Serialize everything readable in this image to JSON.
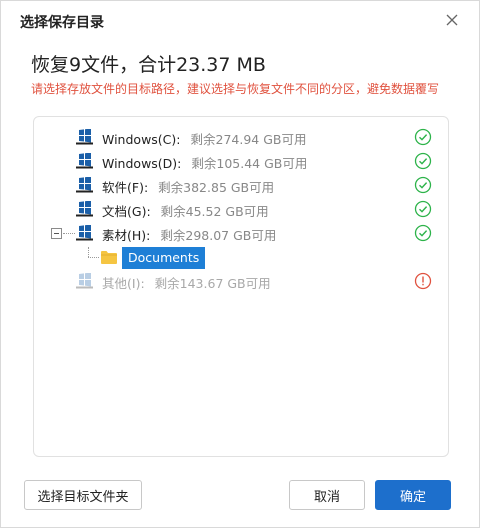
{
  "dialog": {
    "title": "选择保存目录",
    "heading": "恢复9文件，合计23.37 MB",
    "warning": "请选择存放文件的目标路径，建议选择与恢复文件不同的分区，避免数据覆写"
  },
  "drives": [
    {
      "label": "Windows(C):",
      "free": "剩余274.94 GB可用",
      "status": "ok"
    },
    {
      "label": "Windows(D):",
      "free": "剩余105.44 GB可用",
      "status": "ok"
    },
    {
      "label": "软件(F):",
      "free": "剩余382.85 GB可用",
      "status": "ok"
    },
    {
      "label": "文档(G):",
      "free": "剩余45.52 GB可用",
      "status": "ok"
    },
    {
      "label": "素材(H):",
      "free": "剩余298.07 GB可用",
      "status": "ok"
    },
    {
      "label": "其他(I):",
      "free": "剩余143.67 GB可用",
      "status": "error"
    }
  ],
  "selected_folder": "Documents",
  "buttons": {
    "choose": "选择目标文件夹",
    "cancel": "取消",
    "ok": "确定"
  },
  "colors": {
    "ok_green": "#2db34a",
    "error_red": "#e0523f",
    "accent_blue": "#1d6fcc",
    "drive_blue": "#1b5fa8",
    "folder_yellow": "#f5c542"
  },
  "icons": {
    "drive": "windows-drive-icon",
    "ok": "check-circle-icon",
    "error": "info-circle-icon",
    "folder": "folder-icon",
    "close": "close-icon",
    "collapse": "collapse-minus-icon"
  }
}
